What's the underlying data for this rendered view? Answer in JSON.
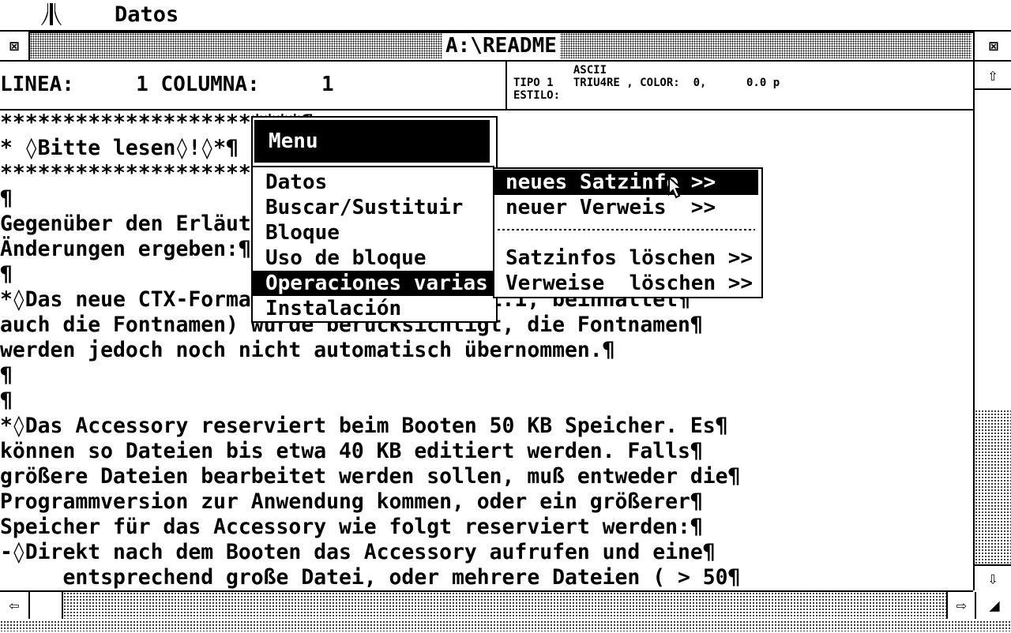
{
  "menubar": {
    "items": [
      "Datos"
    ]
  },
  "window": {
    "title": "A:\\README",
    "close_glyph": "⊠",
    "fuller_glyph": "⊠"
  },
  "status": {
    "position": "LINEA:     1 COLUMNA:     1",
    "info_line1": "         ASCII",
    "info_line2": "TIPO 1   TRIU4RE , COLOR:  0,      0.0 p",
    "info_line3": "ESTILO:"
  },
  "document": {
    "lines": [
      "************************¶",
      "* ◊Bitte lesen◊!◊*¶",
      "************************¶",
      "¶",
      "Gegenüber den Erläut",
      "Änderungen ergeben:¶",
      "¶",
      "*◊Das neue CTX-Forma                on 1.1, beinhaltet¶",
      "auch die Fontnamen) wurde berücksichtigt, die Fontnamen¶",
      "werden jedoch noch nicht automatisch übernommen.¶",
      "¶",
      "¶",
      "*◊Das Accessory reserviert beim Booten 50 KB Speicher. Es¶",
      "können so Dateien bis etwa 40 KB editiert werden. Falls¶",
      "größere Dateien bearbeitet werden sollen, muß entweder die¶",
      "Programmversion zur Anwendung kommen, oder ein größerer¶",
      "Speicher für das Accessory wie folgt reserviert werden:¶",
      "-◊Direkt nach dem Booten das Accessory aufrufen und eine¶",
      "     entsprechend große Datei, oder mehrere Dateien ( > 50¶"
    ]
  },
  "menu": {
    "title": "Menu",
    "items": [
      "Datos",
      "Buscar/Sustituir",
      "Bloque",
      "Uso de bloque",
      "Operaciones varias",
      "Instalación"
    ],
    "selected_index": 4
  },
  "submenu": {
    "items": [
      "neues Satzinfo >>",
      "neuer Verweis  >>",
      "Satzinfos löschen >>",
      "Verweise  löschen >>"
    ],
    "selected_index": 0
  },
  "scroll": {
    "up": "⇧",
    "down": "⇩",
    "left": "⇦",
    "right": "⇨",
    "size": "◢"
  }
}
